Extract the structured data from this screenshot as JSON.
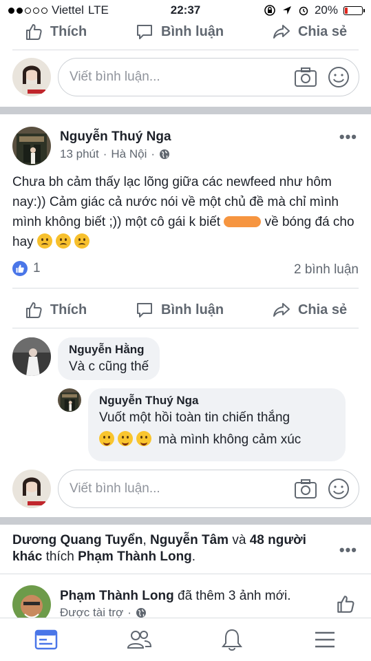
{
  "status_bar": {
    "carrier": "Viettel",
    "network": "LTE",
    "time": "22:37",
    "battery": "20%",
    "battery_level": 0.2,
    "colors": {
      "battery_low": "#e0241b"
    }
  },
  "top_actions": {
    "like": "Thích",
    "comment": "Bình luận",
    "share": "Chia sẻ"
  },
  "composer": {
    "placeholder": "Viết bình luận..."
  },
  "post": {
    "author": "Nguyễn Thuý Nga",
    "time": "13 phút",
    "location": "Hà Nội",
    "text_line1": "Chưa bh cảm thấy lạc lõng giữa các newfeed như hôm nay:)) Cảm giác cả nước nói về một chủ đề mà chỉ mình mình không biết ;)) một cô gái k biết",
    "text_tail": "về bóng đá cho hay",
    "like_count": "1",
    "comment_count": "2 bình luận",
    "actions": {
      "like": "Thích",
      "comment": "Bình luận",
      "share": "Chia sẻ"
    },
    "comments": [
      {
        "author": "Nguyễn Hằng",
        "text": "Và c cũng thế"
      },
      {
        "author": "Nguyễn Thuý Nga",
        "text": "Vuốt một hồi toàn tin chiến thắng",
        "text2": "mà mình không cảm xúc"
      }
    ],
    "composer_placeholder": "Viết bình luận..."
  },
  "story": {
    "name1": "Dương Quang Tuyển",
    "sep": ",",
    "name2": "Nguyễn Tâm",
    "and": "và",
    "others": "48 người khác",
    "liked": "thích",
    "page": "Phạm Thành Long",
    "end": "."
  },
  "story2": {
    "author": "Phạm Thành Long",
    "action": "đã thêm 3 ảnh mới.",
    "meta": "Được tài trợ"
  },
  "colors": {
    "accent": "#4a76e8",
    "gray_text": "#606770",
    "separator": "#c9ccd1",
    "bubble": "#f0f2f5",
    "orange_redaction": "#f5892b"
  }
}
